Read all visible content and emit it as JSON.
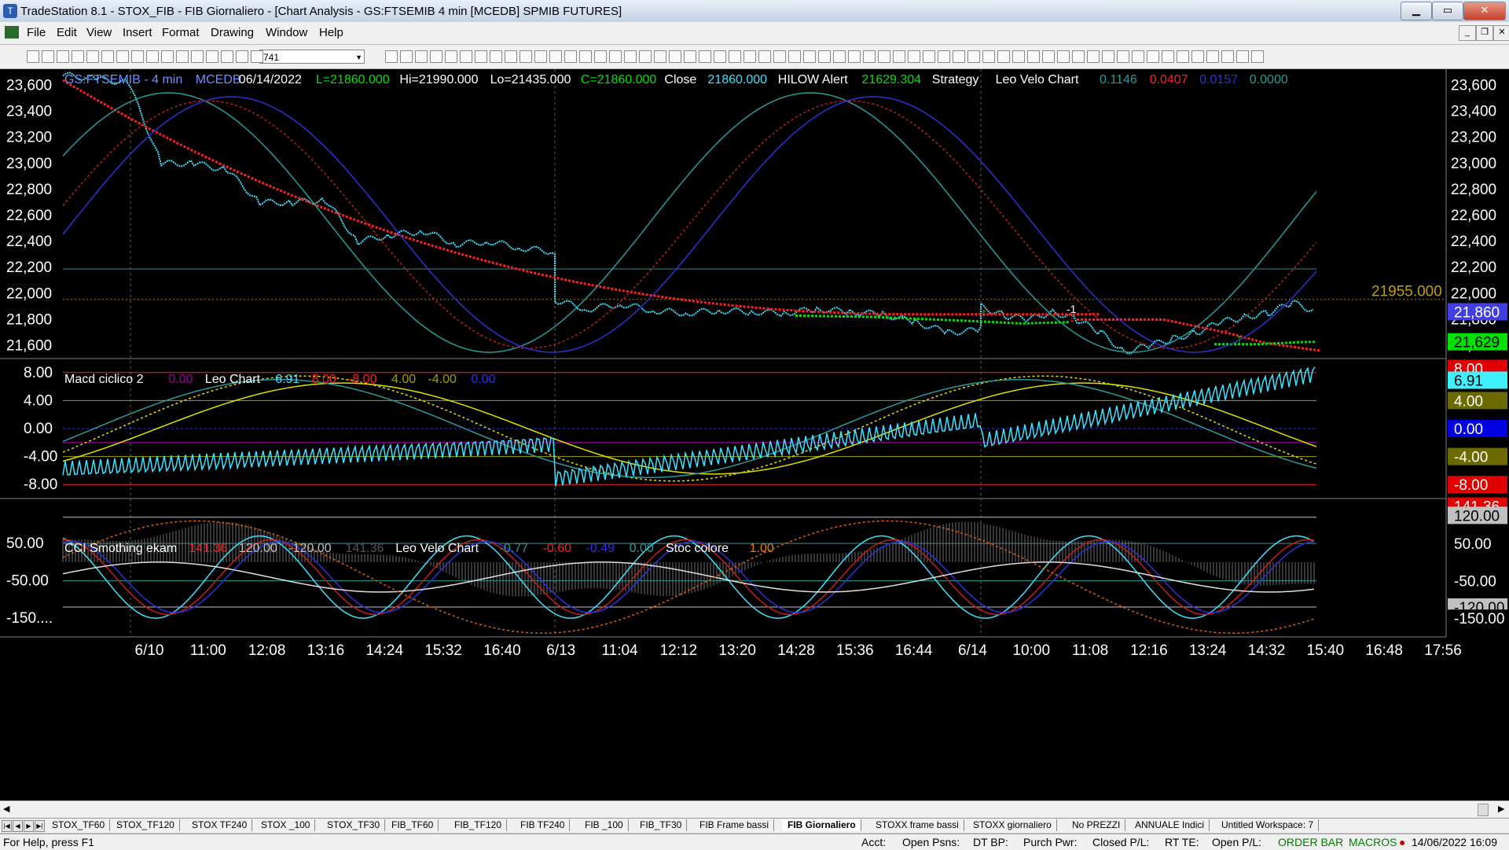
{
  "window": {
    "title": "TradeStation 8.1 - STOX_FIB - FIB Giornaliero - [Chart Analysis - GS:FTSEMIB  4 min  [MCEDB] SPMIB FUTURES]",
    "minimize": "▁",
    "maximize": "▭",
    "close": "✕"
  },
  "menu": [
    "File",
    "Edit",
    "View",
    "Insert",
    "Format",
    "Drawing",
    "Window",
    "Help"
  ],
  "toolbar": {
    "symbol_box": "741"
  },
  "chart": {
    "header": [
      {
        "text": "GS:FTSEMIB - 4 min",
        "color": "#6f8fff"
      },
      {
        "text": "MCEDB",
        "color": "#6f8fff"
      },
      {
        "text": "06/14/2022",
        "color": "#ffffff"
      },
      {
        "text": "L=21860.000",
        "color": "#00e000"
      },
      {
        "text": "Hi=21990.000",
        "color": "#ffffff"
      },
      {
        "text": "Lo=21435.000",
        "color": "#ffffff"
      },
      {
        "text": "C=21860.000",
        "color": "#00e000"
      },
      {
        "text": "Close",
        "color": "#ffffff"
      },
      {
        "text": "21860.000",
        "color": "#40e0ff"
      },
      {
        "text": "HILOW Alert",
        "color": "#ffffff"
      },
      {
        "text": "21629.304",
        "color": "#00e000"
      },
      {
        "text": "Strategy",
        "color": "#ffffff"
      },
      {
        "text": "Leo Velo Chart",
        "color": "#ffffff"
      },
      {
        "text": "0.1146",
        "color": "#2a9a9a"
      },
      {
        "text": "0.0407",
        "color": "#ff2020"
      },
      {
        "text": "0.0157",
        "color": "#3030e0"
      },
      {
        "text": "0.0000",
        "color": "#2a9a9a"
      }
    ],
    "price_axis": [
      "23,600",
      "23,400",
      "23,200",
      "23,000",
      "22,800",
      "22,600",
      "22,400",
      "22,200",
      "22,000",
      "21,800",
      "21,600"
    ],
    "level_label": "21955.000",
    "last_price_tag": "21,860",
    "hilow_tag": "21,629",
    "signal_label": "-1",
    "macd_panel": {
      "header": [
        {
          "text": "Macd ciclico 2",
          "color": "#ffffff"
        },
        {
          "text": "0.00",
          "color": "#a000a0"
        },
        {
          "text": "Leo Chart",
          "color": "#ffffff"
        },
        {
          "text": "6.91",
          "color": "#40e0ff"
        },
        {
          "text": "8.00",
          "color": "#ff2020"
        },
        {
          "text": "-8.00",
          "color": "#ff2020"
        },
        {
          "text": "4.00",
          "color": "#a0a000"
        },
        {
          "text": "-4.00",
          "color": "#a0a000"
        },
        {
          "text": "0.00",
          "color": "#3030e0"
        }
      ],
      "axis": [
        "8.00",
        "4.00",
        "0.00",
        "-4.00",
        "-8.00"
      ],
      "tags": [
        {
          "text": "8.00",
          "bg": "#e00000",
          "fg": "#ffffff"
        },
        {
          "text": "6.91",
          "bg": "#40f0ff",
          "fg": "#000000"
        },
        {
          "text": "4.00",
          "bg": "#6a6a00",
          "fg": "#ffffff"
        },
        {
          "text": "0.00",
          "bg": "#0000e0",
          "fg": "#ffffff"
        },
        {
          "text": "-4.00",
          "bg": "#6a6a00",
          "fg": "#ffffff"
        },
        {
          "text": "-8.00",
          "bg": "#e00000",
          "fg": "#ffffff"
        }
      ]
    },
    "cci_panel": {
      "header": [
        {
          "text": "CCI Smothing ekam",
          "color": "#ffffff"
        },
        {
          "text": "141.36",
          "color": "#ff2020"
        },
        {
          "text": "120.00",
          "color": "#c0c0c0"
        },
        {
          "text": "-120.00",
          "color": "#c0c0c0"
        },
        {
          "text": "141.36",
          "color": "#555555"
        },
        {
          "text": "Leo Velo Chart",
          "color": "#ffffff"
        },
        {
          "text": "-0.77",
          "color": "#2a9a9a"
        },
        {
          "text": "-0.60",
          "color": "#ff2020"
        },
        {
          "text": "-0.49",
          "color": "#3030e0"
        },
        {
          "text": "0.00",
          "color": "#2a9a9a"
        },
        {
          "text": "Stoc colore",
          "color": "#ffffff"
        },
        {
          "text": "1.00",
          "color": "#e08000"
        }
      ],
      "axis": [
        "50.00",
        "-50.00",
        "-150...."
      ],
      "tags": [
        {
          "text": "141.36",
          "bg": "#e00000",
          "fg": "#ffffff"
        },
        {
          "text": "120.00",
          "bg": "#c0c0c0",
          "fg": "#000000"
        },
        {
          "text": "50.00",
          "bg": "#000000",
          "fg": "#ffffff"
        },
        {
          "text": "-50.00",
          "bg": "#000000",
          "fg": "#ffffff"
        },
        {
          "text": "-120.00",
          "bg": "#c0c0c0",
          "fg": "#000000"
        },
        {
          "text": "-150.00",
          "bg": "#000000",
          "fg": "#ffffff"
        }
      ]
    },
    "time_axis": [
      "6/10",
      "11:00",
      "12:08",
      "13:16",
      "14:24",
      "15:32",
      "16:40",
      "6/13",
      "11:04",
      "12:12",
      "13:20",
      "14:28",
      "15:36",
      "16:44",
      "6/14",
      "10:00",
      "11:08",
      "12:16",
      "13:24",
      "14:32",
      "15:40",
      "16:48",
      "17:56"
    ]
  },
  "tabs": [
    "STOX_TF60",
    "STOX_TF120",
    "STOX TF240",
    "STOX _100",
    "STOX_TF30",
    "FIB_TF60",
    "FIB_TF120",
    "FIB TF240",
    "FIB _100",
    "FIB_TF30",
    "FIB Frame bassi",
    "FIB Giornaliero",
    "STOXX frame bassi",
    "STOXX giornaliero",
    "No PREZZI",
    "ANNUALE Indici",
    "Untitled Workspace: 7"
  ],
  "active_tab": "FIB Giornaliero",
  "status": {
    "help": "For Help, press F1",
    "acct": "Acct:",
    "open_psns": "Open Psns:",
    "dt_bp": "DT BP:",
    "purch_pwr": "Purch Pwr:",
    "closed_pl": "Closed P/L:",
    "rt_te": "RT TE:",
    "open_pl": "Open P/L:",
    "order_bar": "ORDER BAR",
    "macros": "MACROS",
    "datetime": "14/06/2022 16:09"
  },
  "chart_data": {
    "type": "line",
    "symbol": "GS:FTSEMIB",
    "interval": "4 min",
    "price_ylim": [
      21500,
      23700
    ],
    "macd_ylim": [
      -10,
      10
    ],
    "cci_ylim": [
      -200,
      170
    ],
    "sessions": [
      {
        "date": "6/10",
        "price": [
          23680,
          23650,
          23620,
          23000,
          23000,
          22950,
          22700,
          22700,
          22720,
          22400,
          22450,
          22480,
          22380,
          22400,
          22350,
          22320
        ]
      },
      {
        "date": "6/13",
        "price": [
          21950,
          21880,
          21920,
          21870,
          21850,
          21870,
          21860,
          21850,
          21880,
          21860,
          21840,
          21780,
          21700,
          21720
        ]
      },
      {
        "date": "6/14",
        "price": [
          21900,
          21830,
          21800,
          21860,
          21800,
          21700,
          21550,
          21600,
          21650,
          21700,
          21780,
          21820,
          21850,
          21930,
          21860
        ]
      }
    ],
    "close": 21860,
    "hilow_alert": 21629.304,
    "high": 21990,
    "low": 21435,
    "level_line": 21955,
    "macd_last": 6.91,
    "cci_last": 141.36
  }
}
